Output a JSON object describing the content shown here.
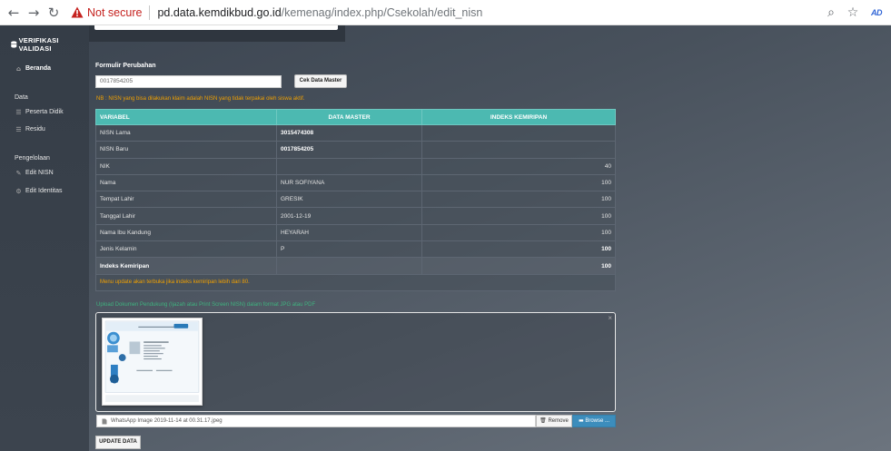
{
  "browser": {
    "not_secure": "Not secure",
    "url_host": "pd.data.kemdikbud.go.id",
    "url_path": "/kemenag/index.php/Csekolah/edit_nisn",
    "profile_badge": "AD"
  },
  "sidebar": {
    "brand": "VERIFIKASI VALIDASI",
    "home": "Beranda",
    "section_data": "Data",
    "peserta_didik": "Peserta Didik",
    "residu": "Residu",
    "section_pengelolaan": "Pengelolaan",
    "edit_nisn": "Edit NISN",
    "edit_identitas": "Edit Identitas"
  },
  "form": {
    "title": "Formulir Perubahan",
    "nisn_value": "0017854205",
    "cek_button": "Cek Data Master",
    "note": "NB : NISN yang bisa dilakukan klaim adalah NISN yang tidak terpakai oleh siswa aktif."
  },
  "table": {
    "headers": [
      "VARIABEL",
      "DATA MASTER",
      "INDEKS KEMIRIPAN"
    ],
    "rows": [
      {
        "label": "NISN Lama",
        "master": "3015474308",
        "index": ""
      },
      {
        "label": "NISN Baru",
        "master": "0017854205",
        "index": ""
      },
      {
        "label": "NIK",
        "master": "",
        "index": "40"
      },
      {
        "label": "Nama",
        "master": "NUR SOFIYANA",
        "index": "100"
      },
      {
        "label": "Tempat Lahir",
        "master": "GRESIK",
        "index": "100"
      },
      {
        "label": "Tanggal Lahir",
        "master": "2001-12-19",
        "index": "100"
      },
      {
        "label": "Nama Ibu Kandung",
        "master": "HEYARAH",
        "index": "100"
      },
      {
        "label": "Jenis Kelamin",
        "master": "P",
        "index": "100"
      }
    ],
    "total_label": "Indeks Kemiripan",
    "total_value": "100",
    "warning": "Menu update akan terbuka jika indeks kemiripan lebih dari 80."
  },
  "upload": {
    "label": "Upload Dokumen Pendukung (Ijazah atau Print Screen NISN) dalam format JPG atau PDF",
    "file_name": "WhatsApp Image 2019-11-14 at 00.31.17.jpeg",
    "remove_button": "Remove",
    "browse_button": "Browse ...",
    "close_glyph": "×"
  },
  "update_button": "UPDATE DATA",
  "colors": {
    "table_header": "#4cb9b1",
    "note_orange": "#f0a000",
    "upload_green": "#3fb37f",
    "browse_blue": "#3c8dbc",
    "not_secure_red": "#c5221f"
  }
}
